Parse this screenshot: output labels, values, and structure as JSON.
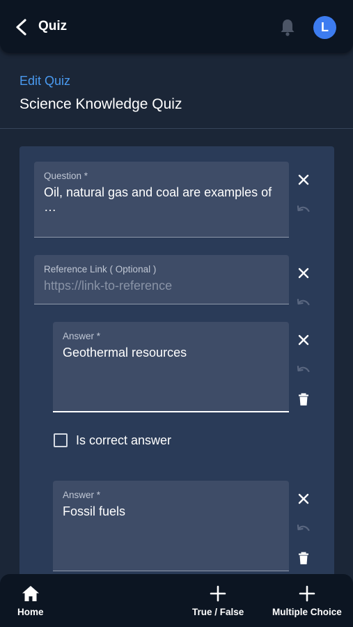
{
  "app_bar": {
    "title": "Quiz",
    "avatar_initial": "L",
    "avatar_color": "#3d7cf0"
  },
  "header": {
    "edit_link": "Edit Quiz",
    "quiz_title": "Science Knowledge Quiz"
  },
  "question_field": {
    "label": "Question *",
    "value": "Oil, natural gas and coal are examples of …"
  },
  "reference_field": {
    "label": "Reference Link ( Optional )",
    "placeholder": "https://link-to-reference"
  },
  "answers": [
    {
      "label": "Answer *",
      "value": "Geothermal resources",
      "correct_label": "Is correct answer",
      "is_correct": false
    },
    {
      "label": "Answer *",
      "value": "Fossil fuels"
    }
  ],
  "bottom_nav": {
    "home": "Home",
    "true_false": "True / False",
    "multiple_choice": "Multiple Choice"
  },
  "icons": [
    "back-arrow-icon",
    "bell-icon",
    "close-icon",
    "undo-icon",
    "trash-icon",
    "checkbox-icon",
    "home-icon",
    "plus-icon"
  ],
  "colors": {
    "accent": "#4a9af0",
    "background": "#1b2637",
    "bar": "#0c1522",
    "card": "#2a3b58",
    "field": "#3e4c67"
  }
}
